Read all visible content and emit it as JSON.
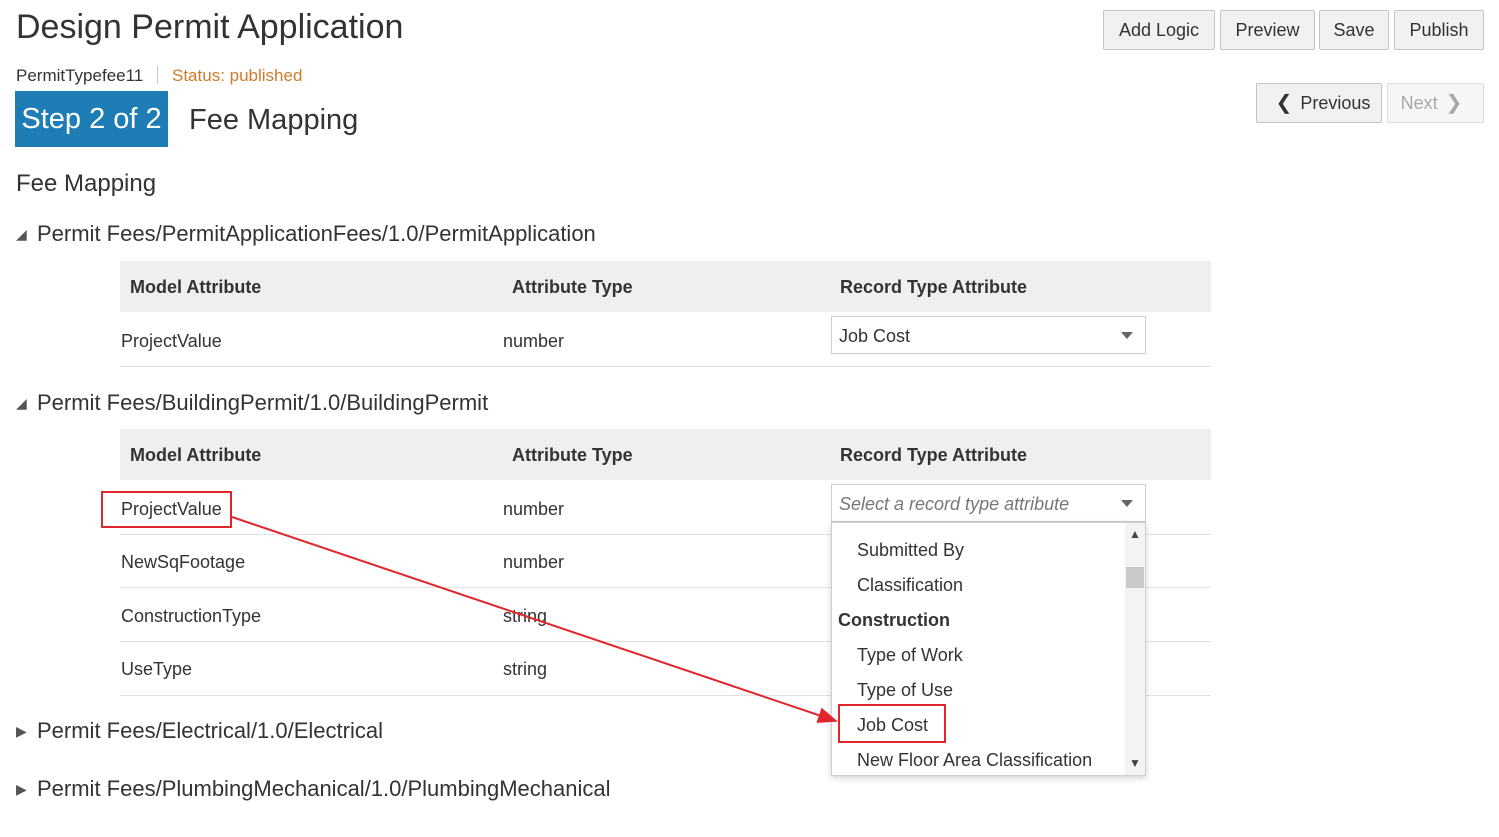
{
  "header": {
    "title": "Design Permit Application",
    "buttons": {
      "add_logic": "Add Logic",
      "preview": "Preview",
      "save": "Save",
      "publish": "Publish"
    }
  },
  "meta": {
    "permit_type": "PermitTypefee11",
    "status": "Status: published"
  },
  "nav": {
    "previous": "Previous",
    "next": "Next"
  },
  "step": {
    "badge": "Step 2 of 2",
    "title": "Fee Mapping"
  },
  "section_title": "Fee Mapping",
  "table_headers": {
    "model_attribute": "Model Attribute",
    "attribute_type": "Attribute Type",
    "record_type_attribute": "Record Type Attribute"
  },
  "groups": [
    {
      "title": "Permit Fees/PermitApplicationFees/1.0/PermitApplication",
      "expanded": true,
      "rows": [
        {
          "model_attribute": "ProjectValue",
          "attribute_type": "number",
          "record_type_attribute": "Job Cost"
        }
      ]
    },
    {
      "title": "Permit Fees/BuildingPermit/1.0/BuildingPermit",
      "expanded": true,
      "select_placeholder": "Select a record type attribute",
      "rows": [
        {
          "model_attribute": "ProjectValue",
          "attribute_type": "number"
        },
        {
          "model_attribute": "NewSqFootage",
          "attribute_type": "number"
        },
        {
          "model_attribute": "ConstructionType",
          "attribute_type": "string"
        },
        {
          "model_attribute": "UseType",
          "attribute_type": "string"
        }
      ]
    },
    {
      "title": "Permit Fees/Electrical/1.0/Electrical",
      "expanded": false
    },
    {
      "title": "Permit Fees/PlumbingMechanical/1.0/PlumbingMechanical",
      "expanded": false
    }
  ],
  "dropdown": {
    "options": [
      "Submitted By",
      "Classification"
    ],
    "group_label": "Construction",
    "group_options": [
      "Type of Work",
      "Type of Use",
      "Job Cost",
      "New Floor Area Classification"
    ]
  },
  "icons": {
    "collapse": "triangle-down-icon",
    "expand": "triangle-right-icon",
    "prev": "chevron-left-icon",
    "next": "chevron-right-icon",
    "caret": "caret-down-icon"
  },
  "colors": {
    "step_badge": "#1f7db6",
    "status": "#d07a2a",
    "highlight": "#e0262b"
  }
}
